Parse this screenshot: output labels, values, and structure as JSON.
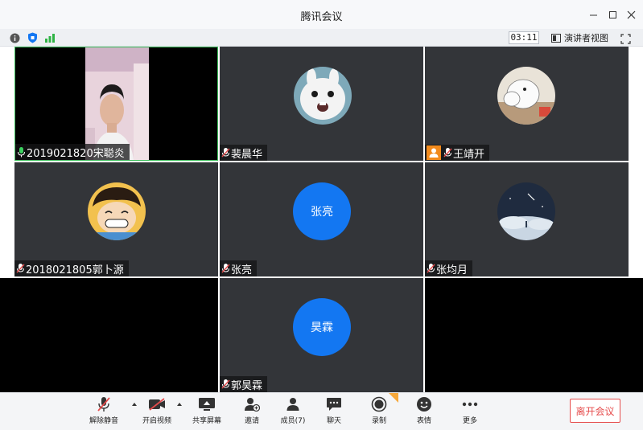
{
  "window": {
    "title": "腾讯会议",
    "minimize_icon": "minimize-icon",
    "maximize_icon": "maximize-icon",
    "close_icon": "close-icon"
  },
  "infobar": {
    "timer": "03:11",
    "presenter_view_label": "演讲者视图"
  },
  "participants": [
    {
      "name": "2019021820宋聪炎",
      "mic": "on",
      "video": true
    },
    {
      "name": "裴晨华",
      "mic": "muted",
      "avatar": "white-rabbit-avatar"
    },
    {
      "name": "王靖开",
      "mic": "muted",
      "avatar": "moomin-avatar"
    },
    {
      "name": "2018021805郭卜源",
      "mic": "muted",
      "avatar": "cartoon-pirate-avatar"
    },
    {
      "name": "张亮",
      "mic": "muted",
      "avatar_text": "张亮"
    },
    {
      "name": "张均月",
      "mic": "muted",
      "avatar": "night-sky-avatar"
    },
    {
      "name": "郭昊霖",
      "mic": "muted",
      "avatar_text": "昊霖"
    }
  ],
  "toolbar": {
    "unmute": "解除静音",
    "start_video": "开启视频",
    "share_screen": "共享屏幕",
    "invite": "邀请",
    "members": "成员(7)",
    "chat": "聊天",
    "record": "录制",
    "reactions": "表情",
    "more": "更多",
    "leave": "离开会议"
  },
  "colors": {
    "accent_blue": "#1377f2",
    "leave_red": "#e64c4c",
    "tile_bg": "#333539"
  }
}
